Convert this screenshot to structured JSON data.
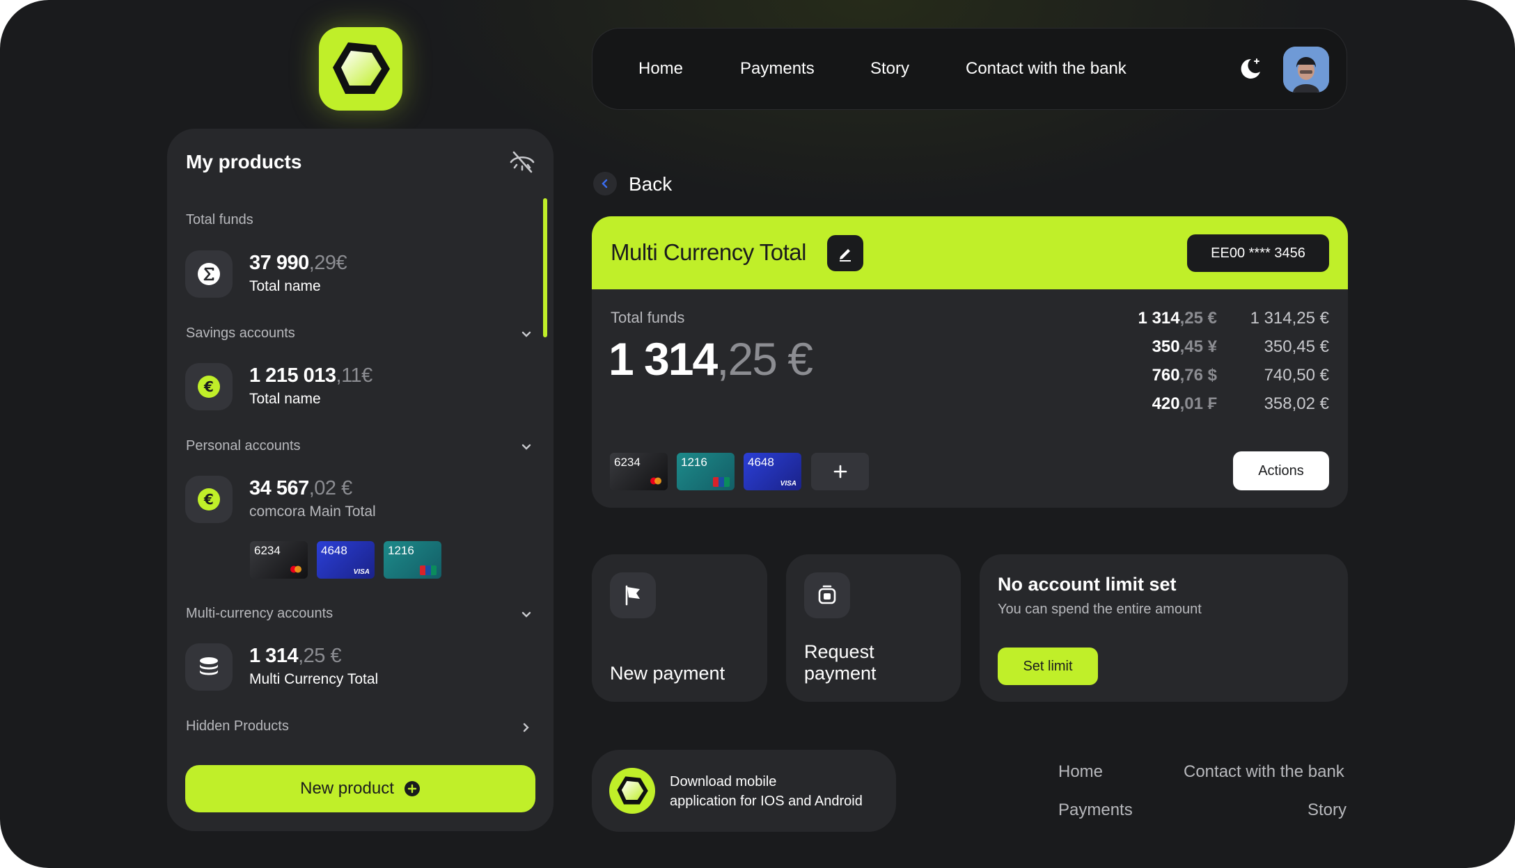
{
  "nav": {
    "items": [
      "Home",
      "Payments",
      "Story",
      "Contact with the bank"
    ]
  },
  "sidebar": {
    "title": "My products",
    "total_funds": {
      "label": "Total funds",
      "amount": "37 990",
      "cents": ",29€",
      "name": "Total name"
    },
    "savings": {
      "label": "Savings accounts",
      "amount": "1 215 013",
      "cents": ",11€",
      "name": "Total name"
    },
    "personal": {
      "label": "Personal accounts",
      "amount": "34 567",
      "cents": ",02 €",
      "name": "comcora Main Total",
      "cards": [
        "6234",
        "4648",
        "1216"
      ]
    },
    "multi": {
      "label": "Multi-currency accounts",
      "amount": "1 314",
      "cents": ",25 €",
      "name": "Multi Currency Total"
    },
    "hidden_label": "Hidden Products",
    "new_product_label": "New product"
  },
  "back_label": "Back",
  "account": {
    "title": "Multi Currency Total",
    "iban": "EE00 **** 3456",
    "total_label": "Total funds",
    "total_amount": "1 314",
    "total_cents": ",25 €",
    "currencies": [
      {
        "amount": "1 314",
        "cents": ",25 €",
        "eur": "1 314,25 €"
      },
      {
        "amount": "350",
        "cents": ",45 ¥",
        "eur": "350,45 €"
      },
      {
        "amount": "760",
        "cents": ",76 $",
        "eur": "740,50 €"
      },
      {
        "amount": "420",
        "cents": ",01 ₣",
        "eur": "358,02 €"
      }
    ],
    "cards": [
      "6234",
      "1216",
      "4648"
    ],
    "card_brand_visa": "VISA",
    "actions_label": "Actions"
  },
  "tiles": {
    "new_payment": "New payment",
    "request_payment_line1": "Request",
    "request_payment_line2": "payment",
    "limit_title": "No account limit set",
    "limit_sub": "You can spend the entire amount",
    "set_limit_label": "Set limit"
  },
  "download": {
    "line1": "Download mobile",
    "line2": "application for IOS and Android"
  },
  "footer": {
    "home": "Home",
    "contact": "Contact with the bank",
    "payments": "Payments",
    "story": "Story"
  },
  "colors": {
    "accent": "#c0ef29",
    "background": "#1a1b1d",
    "surface": "#27282b"
  }
}
